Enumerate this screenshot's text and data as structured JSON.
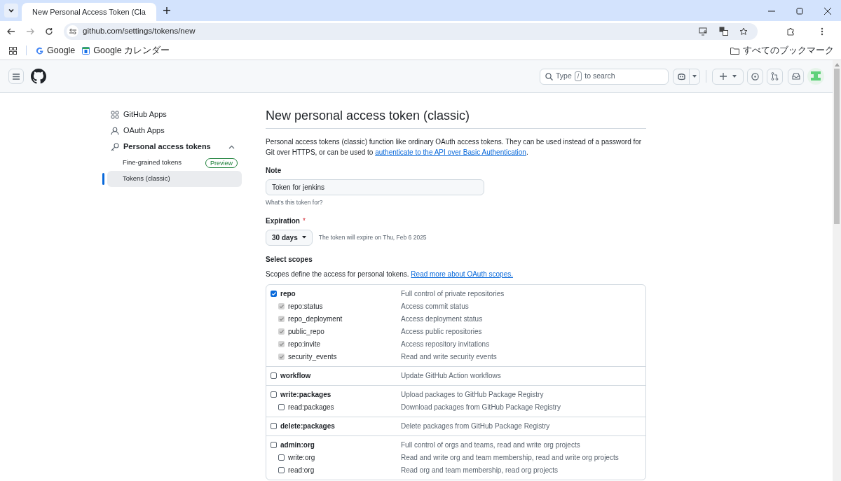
{
  "browser": {
    "tab_title": "New Personal Access Token (Cla",
    "url": "github.com/settings/tokens/new",
    "bookmarks": [
      "Google",
      "Google カレンダー"
    ],
    "all_bookmarks": "すべてのブックマーク"
  },
  "header": {
    "search": {
      "before": "Type",
      "key": "/",
      "after": "to search"
    }
  },
  "sidebar": {
    "items": [
      {
        "label": "GitHub Apps"
      },
      {
        "label": "OAuth Apps"
      },
      {
        "label": "Personal access tokens",
        "expanded": true,
        "children": [
          {
            "label": "Fine-grained tokens",
            "badge": "Preview",
            "selected": false
          },
          {
            "label": "Tokens (classic)",
            "selected": true
          }
        ]
      }
    ]
  },
  "page": {
    "title": "New personal access token (classic)",
    "intro": "Personal access tokens (classic) function like ordinary OAuth access tokens. They can be used instead of a password for Git over HTTPS, or can be used to",
    "intro_link": "authenticate to the API over Basic Authentication",
    "intro_end": ".",
    "note": {
      "label": "Note",
      "value": "Token for jenkins",
      "hint": "What's this token for?"
    },
    "expiration": {
      "label": "Expiration",
      "required": "*",
      "value": "30 days",
      "hint": "The token will expire on Thu, Feb 6 2025"
    },
    "scopes": {
      "label": "Select scopes",
      "intro": "Scopes define the access for personal tokens.",
      "link": "Read more about OAuth scopes.",
      "groups": [
        {
          "name": "repo",
          "description": "Full control of private repositories",
          "checked": true,
          "children": [
            {
              "name": "repo:status",
              "description": "Access commit status",
              "checked": true,
              "disabled": true
            },
            {
              "name": "repo_deployment",
              "description": "Access deployment status",
              "checked": true,
              "disabled": true
            },
            {
              "name": "public_repo",
              "description": "Access public repositories",
              "checked": true,
              "disabled": true
            },
            {
              "name": "repo:invite",
              "description": "Access repository invitations",
              "checked": true,
              "disabled": true
            },
            {
              "name": "security_events",
              "description": "Read and write security events",
              "checked": true,
              "disabled": true
            }
          ]
        },
        {
          "name": "workflow",
          "description": "Update GitHub Action workflows",
          "checked": false
        },
        {
          "name": "write:packages",
          "description": "Upload packages to GitHub Package Registry",
          "checked": false,
          "children": [
            {
              "name": "read:packages",
              "description": "Download packages from GitHub Package Registry",
              "checked": false,
              "disabled": false
            }
          ]
        },
        {
          "name": "delete:packages",
          "description": "Delete packages from GitHub Package Registry",
          "checked": false
        },
        {
          "name": "admin:org",
          "description": "Full control of orgs and teams, read and write org projects",
          "checked": false,
          "children": [
            {
              "name": "write:org",
              "description": "Read and write org and team membership, read and write org projects",
              "checked": false,
              "disabled": false
            },
            {
              "name": "read:org",
              "description": "Read org and team membership, read org projects",
              "checked": false,
              "disabled": false
            }
          ]
        }
      ]
    }
  }
}
